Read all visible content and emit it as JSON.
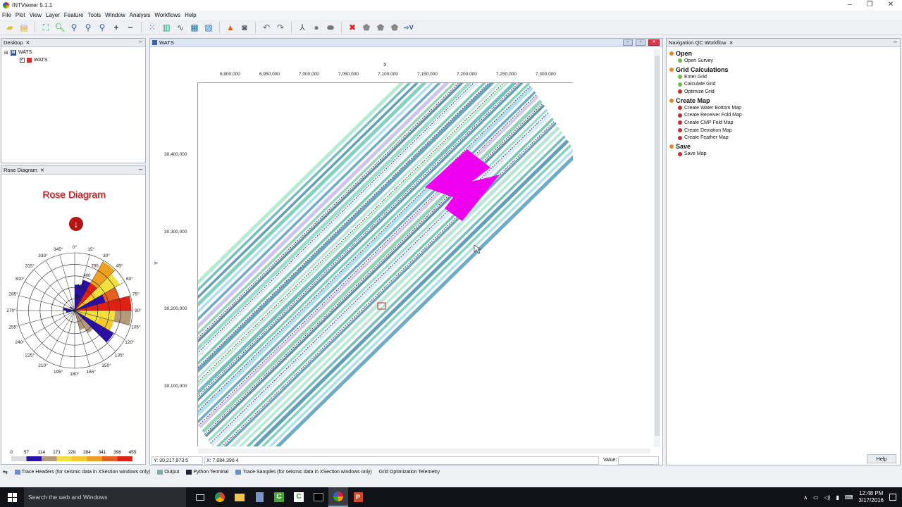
{
  "app": {
    "title": "INTViewer 5.1.1"
  },
  "menu": [
    "File",
    "Plot",
    "View",
    "Layer",
    "Feature",
    "Tools",
    "Window",
    "Analysis",
    "Workflows",
    "Help"
  ],
  "desktop": {
    "tab": "Desktop",
    "root": "WATS",
    "child": "WATS"
  },
  "rose": {
    "tab": "Rose Diagram",
    "title": "Rose Diagram",
    "angles": [
      "0°",
      "15°",
      "30°",
      "45°",
      "60°",
      "75°",
      "90°",
      "105°",
      "120°",
      "135°",
      "150°",
      "165°",
      "180°",
      "195°",
      "210°",
      "225°",
      "240°",
      "255°",
      "270°",
      "285°",
      "300°",
      "315°",
      "330°",
      "345°"
    ],
    "radial": [
      "62",
      "100",
      "400",
      "700"
    ],
    "legend": [
      "0",
      "57",
      "114",
      "171",
      "228",
      "284",
      "341",
      "398",
      "455"
    ],
    "legend_colors": [
      "#2a10a8",
      "#b49a7a",
      "#f0e040",
      "#f5c830",
      "#f0a020",
      "#e86020",
      "#e02010"
    ]
  },
  "map": {
    "tab": "WATS",
    "x_axis_label": "X",
    "y_axis_label": "Y",
    "x_ticks": [
      "6,900,000",
      "6,950,000",
      "7,000,000",
      "7,050,000",
      "7,100,000",
      "7,150,000",
      "7,200,000",
      "7,250,000",
      "7,300,000"
    ],
    "y_ticks": [
      "30,400,000",
      "30,300,000",
      "30,200,000",
      "30,100,000"
    ],
    "status_y": "Y: 30,217,973.5",
    "status_x": "X: 7,084,390.4",
    "value_label": "Value:"
  },
  "workflow": {
    "tab": "Navigation QC Workflow",
    "sections": [
      {
        "title": "Open",
        "items": [
          {
            "label": "Open Survey",
            "color": "#6cbe3c"
          }
        ]
      },
      {
        "title": "Grid Calculations",
        "items": [
          {
            "label": "Enter Grid",
            "color": "#6cbe3c"
          },
          {
            "label": "Calculate Grid",
            "color": "#6cbe3c"
          },
          {
            "label": "Optimize Grid",
            "color": "#c03030"
          }
        ]
      },
      {
        "title": "Create Map",
        "items": [
          {
            "label": "Create Water Bottom Map",
            "color": "#c03030"
          },
          {
            "label": "Create Receiver Fold Map",
            "color": "#c03030"
          },
          {
            "label": "Create CMP Fold Map",
            "color": "#c03030"
          },
          {
            "label": "Create Deviation Map",
            "color": "#c03030"
          },
          {
            "label": "Create Feather Map",
            "color": "#c03030"
          }
        ]
      },
      {
        "title": "Save",
        "items": [
          {
            "label": "Save Map",
            "color": "#c03030"
          }
        ]
      }
    ],
    "help": "Help"
  },
  "bottom_tabs": [
    "Trace Headers (for seismic data in XSection windows only)",
    "Output",
    "Python Terminal",
    "Trace Samples (for seismic data in XSection windows only)",
    "Grid Optimization Telemetry"
  ],
  "taskbar": {
    "search": "Search the web and Windows",
    "time": "12:48 PM",
    "date": "3/17/2016"
  }
}
